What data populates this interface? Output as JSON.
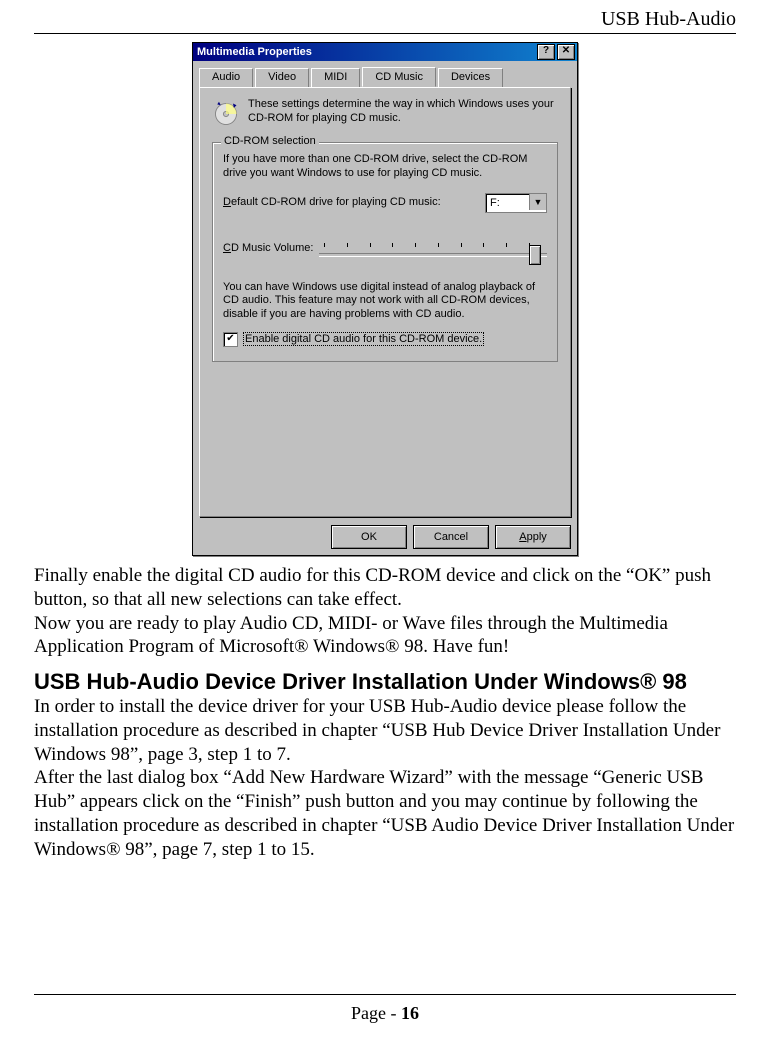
{
  "header": {
    "title": "USB Hub-Audio"
  },
  "dialog": {
    "title": "Multimedia Properties",
    "help_btn": "?",
    "close_btn": "✕",
    "tabs": [
      "Audio",
      "Video",
      "MIDI",
      "CD Music",
      "Devices"
    ],
    "active_tab_index": 3,
    "top_desc": "These settings determine the way in which Windows uses your CD-ROM for playing CD music.",
    "group": {
      "legend": "CD-ROM selection",
      "intro": "If you have more than one CD-ROM drive, select the CD-ROM drive you want Windows to use for playing CD music.",
      "default_label": "Default CD-ROM drive for playing CD music:",
      "default_value": "F:",
      "volume_label": "CD Music Volume:",
      "digital_text": "You can have Windows use digital instead of analog playback of CD audio.  This feature may not work with all CD-ROM devices, disable if you are having problems with CD audio.",
      "checkbox_label": "Enable digital CD audio for this CD-ROM device.",
      "checkbox_checked": true
    },
    "buttons": {
      "ok": "OK",
      "cancel": "Cancel",
      "apply": "Apply"
    }
  },
  "para1": "Finally enable the digital CD audio for this CD-ROM device and click on the “OK” push button, so that all new selections can take effect.",
  "para2": "Now you are ready to play Audio CD, MIDI- or Wave files through the Multimedia Application Program of Microsoft® Windows® 98. Have fun!",
  "section_heading": "USB Hub-Audio Device Driver Installation Under Windows® 98",
  "para3": "In order to install the device driver for your USB Hub-Audio device please follow the installation procedure as described in chapter “USB Hub Device Driver Installation Under Windows 98”, page 3, step 1 to 7.",
  "para4": "After the last dialog box “Add New Hardware Wizard” with the message “Generic USB Hub” appears click on the “Finish” push button and you may continue by following the installation procedure as described in chapter “USB Audio Device Driver Installation Under Windows® 98”, page 7, step 1 to 15.",
  "footer": {
    "label": "Page - ",
    "number": "16"
  }
}
